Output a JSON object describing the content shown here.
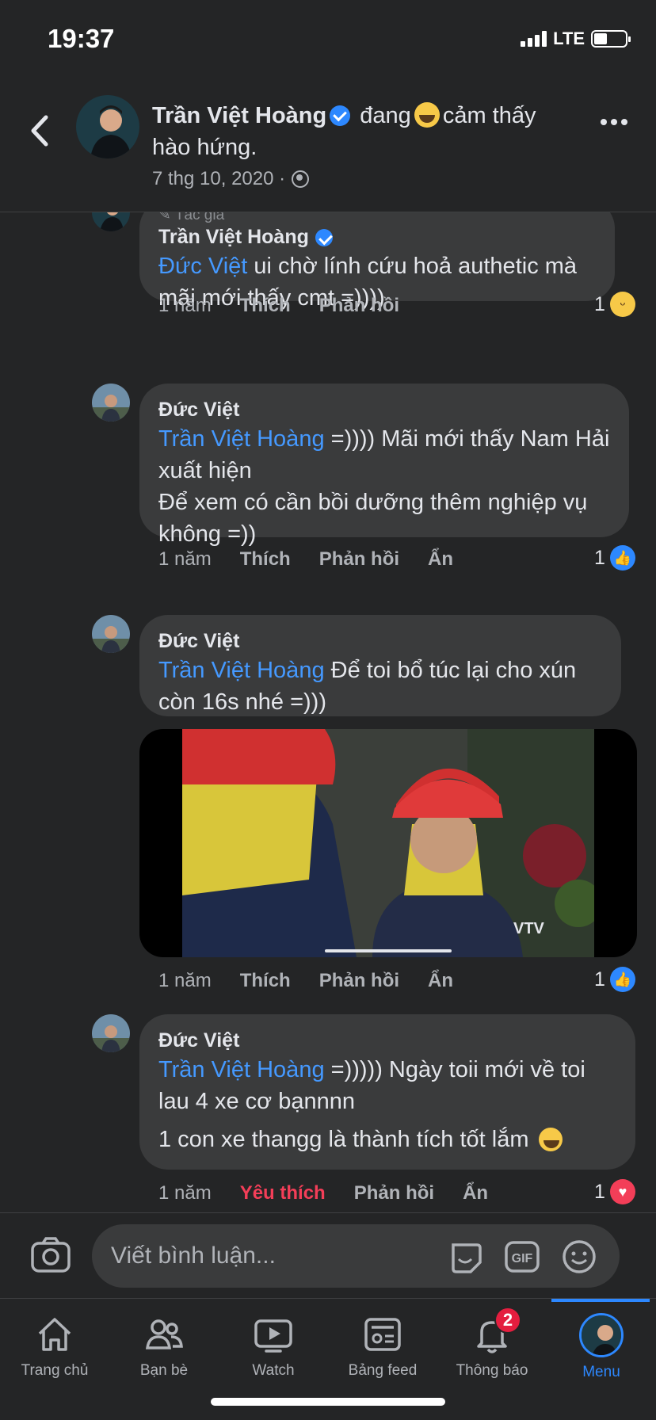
{
  "status_bar": {
    "time": "19:37",
    "network": "LTE",
    "battery_level": 0.35
  },
  "header": {
    "author": "Trần Việt Hoàng",
    "activity_before": "đang",
    "activity_after": "cảm thấy hào hứng.",
    "date": "7 thg 10, 2020 ·"
  },
  "comments": [
    {
      "author_tag": "Tác giả",
      "author": "Trần Việt Hoàng",
      "mention": "Đức Việt",
      "text": " ui chờ lính cứu hoả authetic mà mãi mới thấy cmt =))))",
      "when": "1 năm",
      "like_label": "Thích",
      "reply_label": "Phản hồi",
      "hide_label": "",
      "reaction_count": "1",
      "reaction_type": "haha"
    },
    {
      "author": "Đức Việt",
      "mention": "Trần Việt Hoàng",
      "text": "  =)))) Mãi mới thấy Nam Hải xuất hiện",
      "text2": "Để xem có cần bồi dưỡng thêm nghiệp vụ không =))",
      "when": "1 năm",
      "like_label": "Thích",
      "reply_label": "Phản hồi",
      "hide_label": "Ẩn",
      "reaction_count": "1",
      "reaction_type": "like"
    },
    {
      "author": "Đức Việt",
      "mention": "Trần Việt Hoàng",
      "text": " Để toi bổ túc lại cho xún còn 16s nhé =)))",
      "when": "1 năm",
      "like_label": "Thích",
      "reply_label": "Phản hồi",
      "hide_label": "Ẩn",
      "reaction_count": "1",
      "reaction_type": "like",
      "video_progress": 0.0
    },
    {
      "author": "Đức Việt",
      "mention": "Trần Việt Hoàng",
      "text": "  =))))) Ngày toii mới về toi lau 4 xe cơ bạnnnn",
      "text2": "1 con xe thangg là thành tích tốt lắm",
      "when": "1 năm",
      "like_label": "Yêu thích",
      "reply_label": "Phản hồi",
      "hide_label": "Ẩn",
      "reaction_count": "1",
      "reaction_type": "love"
    }
  ],
  "composer": {
    "placeholder": "Viết bình luận..."
  },
  "tabs": [
    {
      "label": "Trang chủ",
      "icon": "home-icon"
    },
    {
      "label": "Bạn bè",
      "icon": "friends-icon"
    },
    {
      "label": "Watch",
      "icon": "watch-icon"
    },
    {
      "label": "Bảng feed",
      "icon": "feed-icon"
    },
    {
      "label": "Thông báo",
      "icon": "bell-icon",
      "badge": "2"
    },
    {
      "label": "Menu",
      "icon": "menu-avatar",
      "active": true
    }
  ],
  "colors": {
    "accent": "#2d88ff",
    "mention": "#4599ff",
    "love": "#f33e58",
    "bubble": "#3a3b3c",
    "background": "#242526"
  }
}
